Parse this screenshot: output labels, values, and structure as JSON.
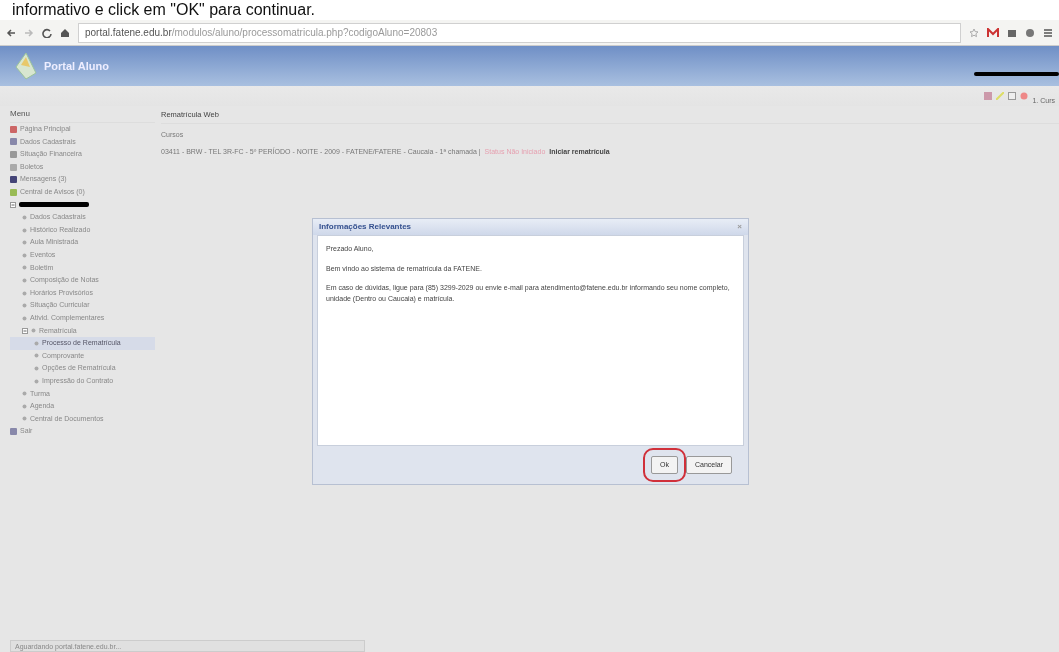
{
  "caption": "informativo e click em \"OK\" para continuar.",
  "browser": {
    "url_host": "portal.fatene.edu.br",
    "url_path": "/modulos/aluno/processomatricula.php?codigoAluno=20803"
  },
  "header": {
    "logo_text": "Portal Aluno",
    "user_text": "1. Curs"
  },
  "sidebar": {
    "title": "Menu",
    "items": [
      {
        "label": "Página Principal",
        "kind": "link"
      },
      {
        "label": "Dados Cadastrais",
        "kind": "link"
      },
      {
        "label": "Situação Financeira",
        "kind": "link"
      },
      {
        "label": "Boletos",
        "kind": "link"
      },
      {
        "label": "Mensagens (3)",
        "kind": "link"
      },
      {
        "label": "Central de Avisos (0)",
        "kind": "link"
      },
      {
        "kind": "redacted",
        "expanded": true,
        "children": [
          {
            "label": "Dados Cadastrais",
            "selected": false
          },
          {
            "label": "Histórico Realizado",
            "selected": false
          },
          {
            "label": "Aula Ministrada",
            "selected": false
          },
          {
            "label": "Eventos",
            "selected": false
          },
          {
            "label": "Boletim",
            "selected": false
          },
          {
            "label": "Composição de Notas",
            "selected": false
          },
          {
            "label": "Horários Provisórios",
            "selected": false
          },
          {
            "label": "Situação Curricular",
            "selected": false
          },
          {
            "label": "Ativid. Complementares",
            "selected": false
          },
          {
            "label": "Rematrícula",
            "selected": false,
            "expanded": true,
            "children": [
              {
                "label": "Processo de Rematrícula",
                "selected": true
              },
              {
                "label": "Comprovante",
                "selected": false
              },
              {
                "label": "Opções de Rematrícula",
                "selected": false
              },
              {
                "label": "Impressão do Contrato",
                "selected": false
              }
            ]
          },
          {
            "label": "Turma",
            "selected": false
          },
          {
            "label": "Agenda",
            "selected": false
          },
          {
            "label": "Central de Documentos",
            "selected": false
          }
        ]
      },
      {
        "label": "Sair",
        "kind": "link"
      }
    ]
  },
  "main": {
    "title": "Rematrícula Web",
    "subtitle": "Cursos",
    "course_line": "03411 - BRW - TEL 3R-FC - 5º PERÍODO - NOITE - 2009 - FATENE/FATERE - Caucaia - 1ª chamada |",
    "status_text": "Status Não Iniciado",
    "action_link": "Iniciar rematrícula"
  },
  "dialog": {
    "title": "Informações Relevantes",
    "close": "×",
    "paragraphs": [
      "Prezado Aluno,",
      "Bem vindo ao sistema de rematrícula da FATENE.",
      "Em caso de dúvidas, ligue para (85) 3299-2029 ou envie e-mail para atendimento@fatene.edu.br informando seu nome completo, unidade (Dentro ou Caucaia) e matrícula."
    ],
    "buttons": [
      {
        "label": "Ok",
        "highlighted": true
      },
      {
        "label": "Cancelar",
        "highlighted": false
      }
    ]
  },
  "status_bar": "Aguardando portal.fatene.edu.br..."
}
